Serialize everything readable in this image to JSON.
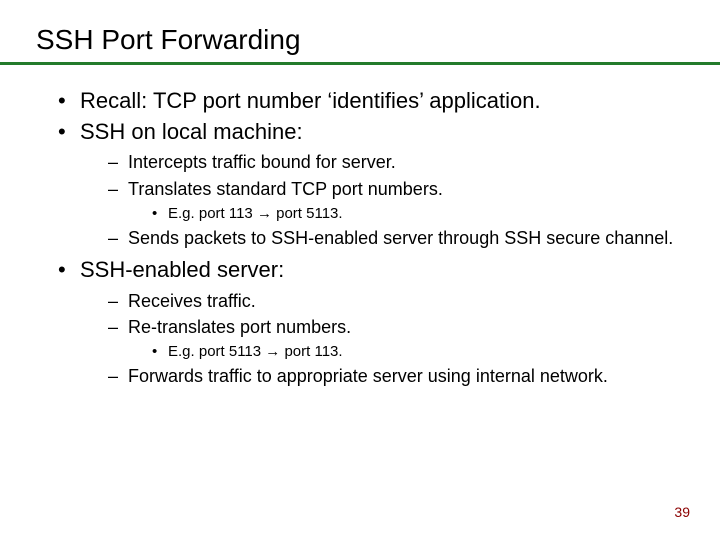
{
  "title": "SSH Port Forwarding",
  "b1": "Recall: TCP port number ‘identifies’ application.",
  "b2": "SSH on local machine:",
  "b2a": "Intercepts traffic bound for server.",
  "b2b": "Translates standard TCP port numbers.",
  "b2b1": "E.g. port 113 → port 5113.",
  "b2c": "Sends packets to SSH-enabled server through SSH secure channel.",
  "b3": "SSH-enabled server:",
  "b3a": "Receives traffic.",
  "b3b": "Re-translates port numbers.",
  "b3b1": "E.g. port 5113 → port 113.",
  "b3c": "Forwards traffic to appropriate server using internal network.",
  "page": "39"
}
